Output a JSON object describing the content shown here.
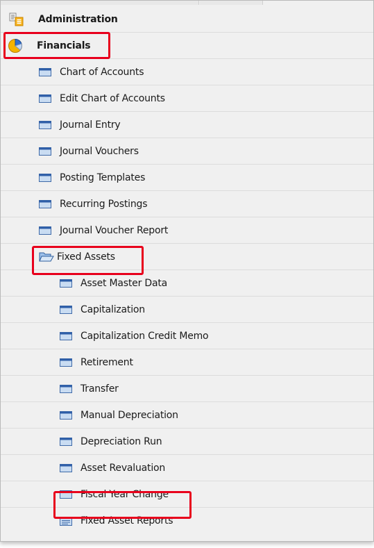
{
  "menu": {
    "administration": "Administration",
    "financials": "Financials",
    "financials_items": [
      "Chart of Accounts",
      "Edit Chart of Accounts",
      "Journal Entry",
      "Journal Vouchers",
      "Posting Templates",
      "Recurring Postings",
      "Journal Voucher Report"
    ],
    "fixed_assets": "Fixed Assets",
    "fixed_assets_items": [
      "Asset Master Data",
      "Capitalization",
      "Capitalization Credit Memo",
      "Retirement",
      "Transfer",
      "Manual Depreciation",
      "Depreciation Run",
      "Asset Revaluation",
      "Fiscal Year Change"
    ],
    "fixed_asset_reports": "Fixed Asset Reports"
  },
  "icons": {
    "administration": "admin-icon",
    "financials": "pie-chart-icon",
    "form": "window-form-icon",
    "folder_open": "folder-open-icon",
    "report_folder": "report-folder-icon"
  },
  "colors": {
    "highlight": "#e8001c",
    "background": "#f0f0f0"
  }
}
